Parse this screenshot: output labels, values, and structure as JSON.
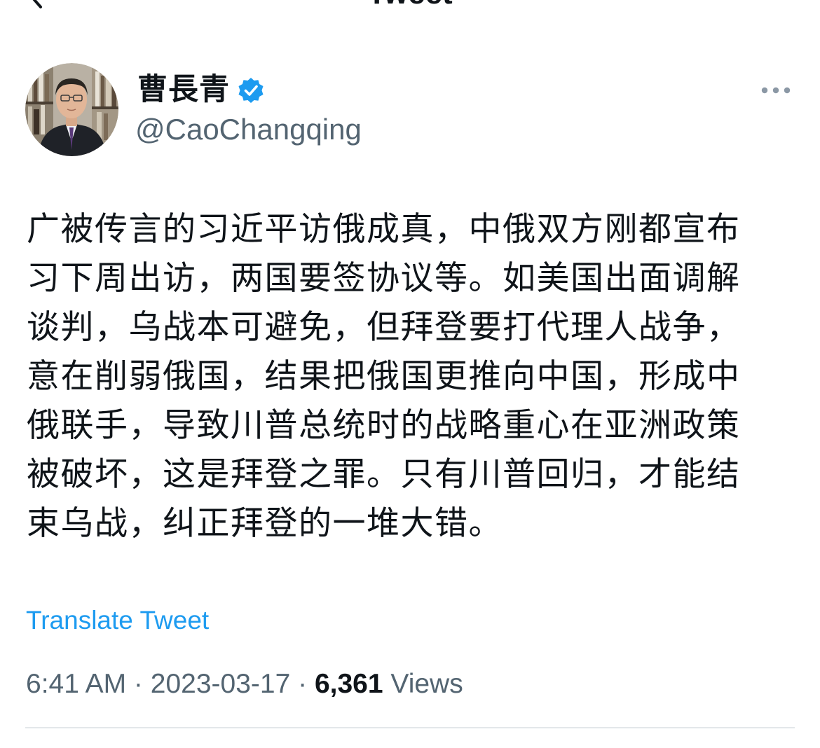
{
  "header": {
    "title": "Tweet",
    "back_icon": "chevron-left-icon"
  },
  "author": {
    "display_name": "曹長青",
    "handle": "@CaoChangqing",
    "verified": true,
    "verified_color": "#1d9bf0",
    "more_icon": "more-horizontal-icon"
  },
  "tweet": {
    "text_lines": [
      "广被传言的习近平访俄成真，中俄双方刚都宣布",
      "习下周出访，两国要签协议等。如美国出面调解",
      "谈判，乌战本可避免，但拜登要打代理人战争，",
      "意在削弱俄国，结果把俄国更推向中国，形成中",
      "俄联手，导致川普总统时的战略重心在亚洲政策",
      "被破坏，这是拜登之罪。只有川普回归，才能结",
      "束乌战，纠正拜登的一堆大错。"
    ],
    "translate_label": "Translate Tweet",
    "time": "6:41 AM",
    "separator": " · ",
    "date": "2023-03-17",
    "views_count": "6,361",
    "views_label": " Views"
  },
  "colors": {
    "link": "#1d9bf0",
    "text": "#0f1419",
    "secondary": "#536471",
    "divider": "#e3e7ea"
  }
}
